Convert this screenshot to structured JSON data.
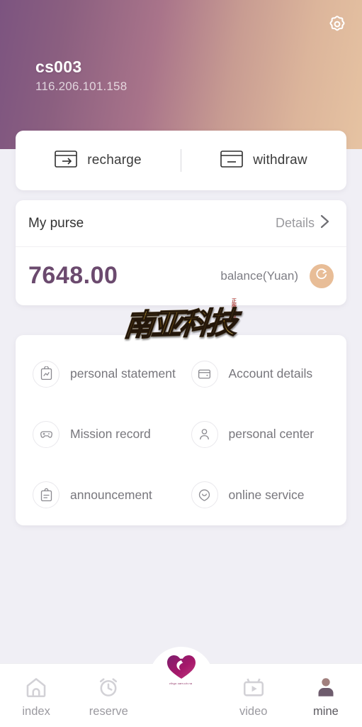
{
  "header": {
    "username": "cs003",
    "ip_address": "116.206.101.158",
    "settings_icon": "gear-icon",
    "gradient_start": "#7c5480",
    "gradient_end": "#e6c3a2"
  },
  "actions": {
    "recharge": {
      "label": "recharge",
      "icon": "card-arrow-right-icon"
    },
    "withdraw": {
      "label": "withdraw",
      "icon": "card-minus-icon"
    }
  },
  "purse": {
    "title": "My purse",
    "details_label": "Details",
    "details_icon": "chevron-right-icon",
    "balance": "7648.00",
    "balance_label": "balance(Yuan)",
    "balance_color": "#6b4a6e",
    "refresh_icon": "refresh-icon",
    "refresh_bg": "#e8bd97"
  },
  "watermark": {
    "text": "南亚科技",
    "seal": "正版科技"
  },
  "menu": {
    "items": [
      {
        "label": "personal statement",
        "icon": "clipboard-chart-icon"
      },
      {
        "label": "Account details",
        "icon": "wallet-icon"
      },
      {
        "label": "Mission record",
        "icon": "gamepad-icon"
      },
      {
        "label": "personal center",
        "icon": "user-icon"
      },
      {
        "label": "announcement",
        "icon": "clipboard-lines-icon"
      },
      {
        "label": "online service",
        "icon": "headset-chat-icon"
      }
    ]
  },
  "tabbar": {
    "tabs": [
      {
        "label": "index",
        "icon": "home-icon",
        "active": false
      },
      {
        "label": "reserve",
        "icon": "alarm-clock-icon",
        "active": false
      },
      {
        "label": "video",
        "icon": "video-play-icon",
        "active": false
      },
      {
        "label": "mine",
        "icon": "person-icon",
        "active": true
      }
    ],
    "center": {
      "icon": "heart-logo-icon",
      "sub_text": "vihgo cam.ub.na",
      "color": "#9c1f63"
    }
  },
  "theme": {
    "page_bg": "#f0eff5",
    "card_bg": "#ffffff",
    "accent": "#6b4a6e"
  }
}
